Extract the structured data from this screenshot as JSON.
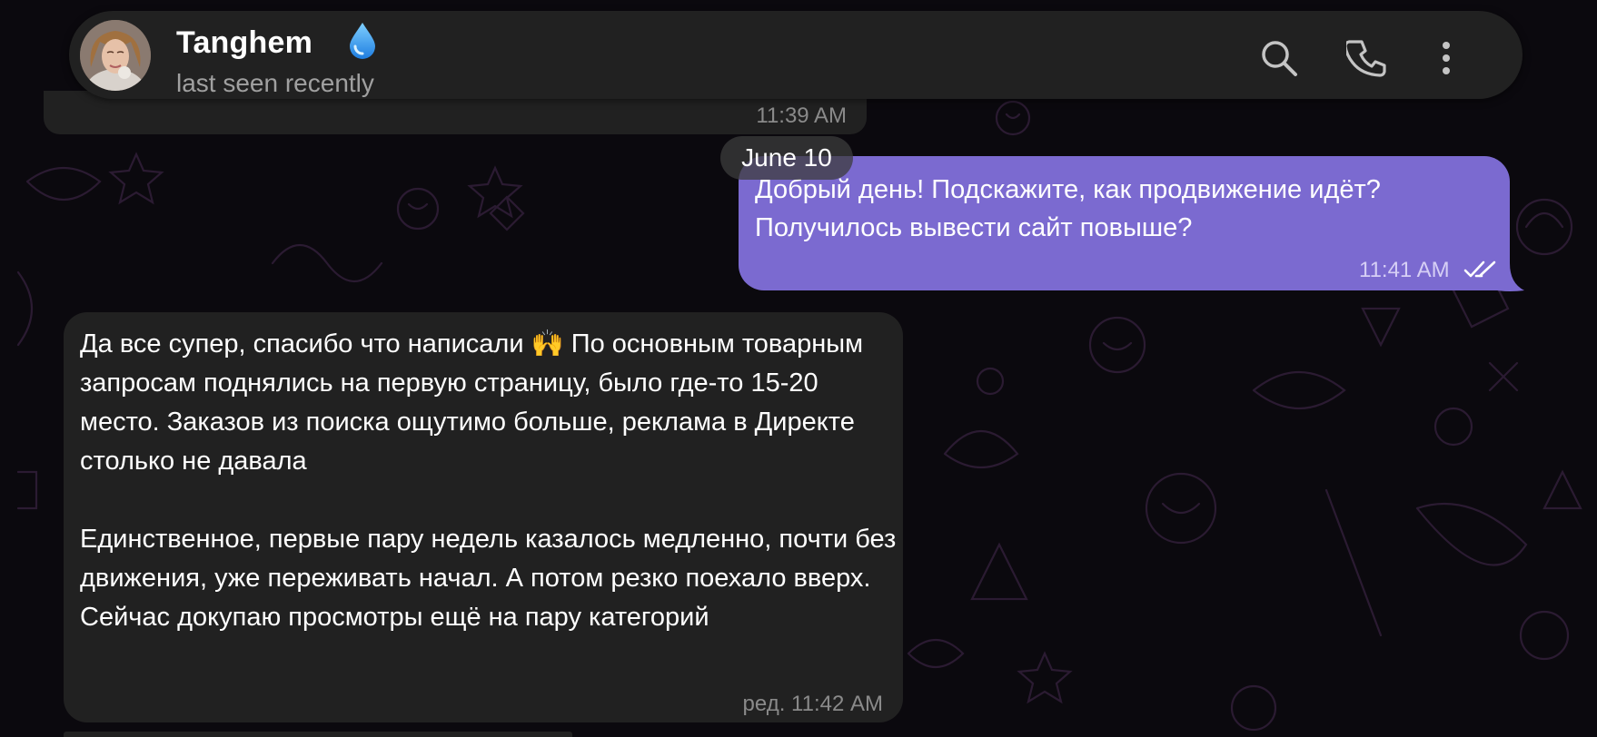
{
  "header": {
    "name": "Tanghem",
    "status": "last seen recently",
    "badge_icon": "water-drop-icon",
    "actions": [
      "search-icon",
      "phone-icon",
      "more-vertical-icon"
    ]
  },
  "previous_message": {
    "time": "11:39 AM"
  },
  "date_separator": "June 10",
  "outgoing_message": {
    "text": "Добрый день! Подскажите, как продвижение идёт? Получилось вывести сайт повыше?",
    "time": "11:41 AM",
    "status_icon": "double-check-icon"
  },
  "incoming_message": {
    "text": "Да все супер, спасибо что написали 🙌 По основным товарным запросам поднялись на первую страницу, было где-то 15-20 место. Заказов из поиска ощутимо больше, реклама в Директе столько не давала\n\nЕдинственное, первые пару недель казалось медленно, почти без движения, уже переживать начал. А потом резко поехало вверх. Сейчас докупаю просмотры ещё на пару категорий",
    "time": "ред. 11:42 AM"
  },
  "colors": {
    "background": "#0b090e",
    "header": "#212121",
    "outgoing_bubble": "#7b6ad0",
    "incoming_bubble": "#212121",
    "wallpaper_doodles": "#2a1a30"
  }
}
